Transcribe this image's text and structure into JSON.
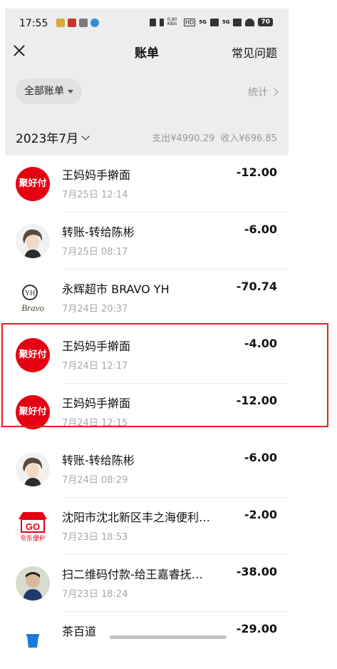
{
  "status_bar": {
    "time": "17:55",
    "net_speed": "0.90 KB/s",
    "hd": "HD",
    "net1": "5G",
    "net2": "5G",
    "battery": "70"
  },
  "nav": {
    "title": "账单",
    "right_label": "常见问题"
  },
  "filter": {
    "label": "全部账单",
    "stats_label": "统计"
  },
  "month": {
    "label": "2023年7月",
    "expense": "支出¥4990.29",
    "income": "收入¥696.85"
  },
  "transactions": [
    {
      "title": "王妈妈手擀面",
      "time": "7月25日 12:14",
      "amount": "-12.00",
      "avatar": "聚好付"
    },
    {
      "title": "转账-转给陈彬",
      "time": "7月25日 08:17",
      "amount": "-6.00",
      "avatar": "person-avatar"
    },
    {
      "title": "永辉超市 BRAVO YH",
      "time": "7月24日 20:37",
      "amount": "-70.74",
      "avatar": "Bravo"
    },
    {
      "title": "王妈妈手擀面",
      "time": "7月24日 12:17",
      "amount": "-4.00",
      "avatar": "聚好付"
    },
    {
      "title": "王妈妈手擀面",
      "time": "7月24日 12:15",
      "amount": "-12.00",
      "avatar": "聚好付"
    },
    {
      "title": "转账-转给陈彬",
      "time": "7月24日 08:29",
      "amount": "-6.00",
      "avatar": "person-avatar"
    },
    {
      "title": "沈阳市沈北新区丰之海便利…",
      "time": "7月23日 18:53",
      "amount": "-2.00",
      "avatar": "京东便利"
    },
    {
      "title": "扫二维码付款-给王嘉睿抚…",
      "time": "7月23日 18:24",
      "amount": "-38.00",
      "avatar": "photo-avatar"
    },
    {
      "title": "茶百道",
      "time": "",
      "amount": "-29.00",
      "avatar": "cup-icon"
    }
  ],
  "colors": {
    "accent_red": "#e60012",
    "highlight_border": "#e0231e",
    "header_bg": "#ededed"
  }
}
